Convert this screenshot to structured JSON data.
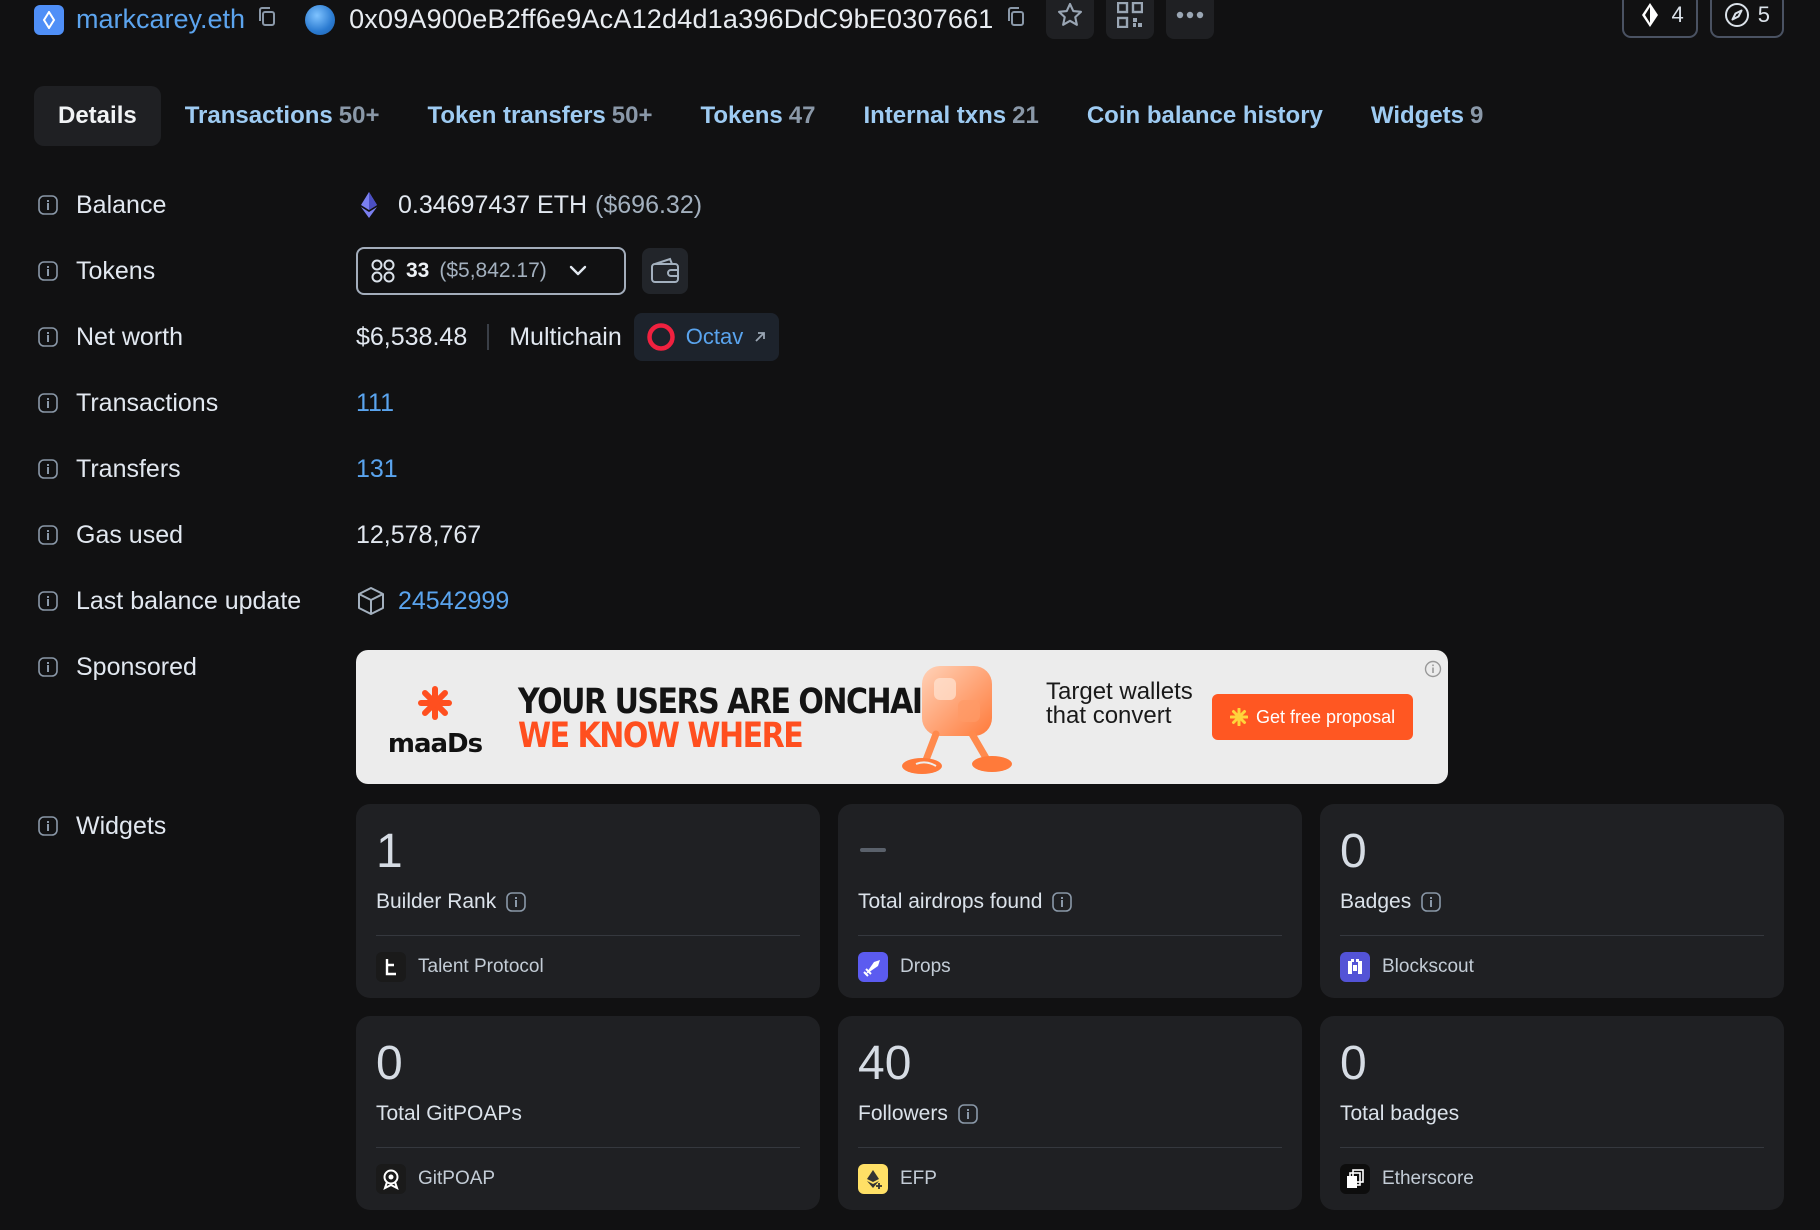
{
  "header": {
    "ens_name": "markcarey.eth",
    "address": "0x09A900eB2ff6e9AcA12d4d1a396DdC9bE0307661",
    "pill_left_count": "4",
    "pill_right_count": "5"
  },
  "tabs": [
    {
      "label": "Details",
      "count": ""
    },
    {
      "label": "Transactions",
      "count": "50+"
    },
    {
      "label": "Token transfers",
      "count": "50+"
    },
    {
      "label": "Tokens",
      "count": "47"
    },
    {
      "label": "Internal txns",
      "count": "21"
    },
    {
      "label": "Coin balance history",
      "count": ""
    },
    {
      "label": "Widgets",
      "count": "9"
    }
  ],
  "details": {
    "balance_label": "Balance",
    "balance_value": "0.34697437 ETH",
    "balance_usd": "($696.32)",
    "tokens_label": "Tokens",
    "tokens_count": "33",
    "tokens_usd": "($5,842.17)",
    "networth_label": "Net worth",
    "networth_value": "$6,538.48",
    "multichain_label": "Multichain",
    "octav_label": "Octav",
    "transactions_label": "Transactions",
    "transactions_value": "111",
    "transfers_label": "Transfers",
    "transfers_value": "131",
    "gas_label": "Gas used",
    "gas_value": "12,578,767",
    "last_update_label": "Last balance update",
    "last_update_value": "24542999",
    "sponsored_label": "Sponsored",
    "widgets_label": "Widgets"
  },
  "ad": {
    "brand": "maaDs",
    "headline_1": "YOUR USERS ARE ONCHAIN.",
    "headline_2": "WE KNOW WHERE",
    "tagline": "Target wallets that convert",
    "cta": "Get free proposal",
    "colors": {
      "accent": "#ff5722",
      "background": "#ececec"
    }
  },
  "widgets": [
    {
      "value": "1",
      "label": "Builder Rank",
      "info": true,
      "source": "Talent Protocol"
    },
    {
      "value": "",
      "label": "Total airdrops found",
      "info": true,
      "source": "Drops"
    },
    {
      "value": "0",
      "label": "Badges",
      "info": true,
      "source": "Blockscout"
    },
    {
      "value": "0",
      "label": "Total GitPOAPs",
      "info": false,
      "source": "GitPOAP"
    },
    {
      "value": "40",
      "label": "Followers",
      "info": true,
      "source": "EFP"
    },
    {
      "value": "0",
      "label": "Total badges",
      "info": false,
      "source": "Etherscore"
    }
  ],
  "colors": {
    "background": "#111112",
    "link": "#5aa4ee",
    "card": "#1f2023",
    "tab_text": "#9ecbf2"
  }
}
